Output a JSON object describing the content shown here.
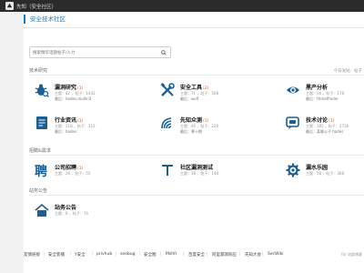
{
  "topbar": {
    "site_name": "先知（安全社区）"
  },
  "forum": {
    "title": "安全技术社区"
  },
  "search": {
    "placeholder": "搜索精华话题帖子/人力"
  },
  "sections": {
    "tech": {
      "title": "技术研究",
      "right": "今日发贴 · 帖子"
    },
    "recruit": {
      "title": "招聘&需求"
    },
    "notice": {
      "title": "站务公告"
    }
  },
  "tech_items": [
    {
      "name": "漏洞研究",
      "count": "(1)",
      "stats": "主题：82 ，帖子：1442",
      "last": "最后：hades.mullin3",
      "icon": "bug-icon"
    },
    {
      "name": "安全工具",
      "count": "(2)",
      "stats": "主题：71 ，帖子：508",
      "last": "最后：wolf",
      "icon": "tools-icon"
    },
    {
      "name": "黑产分析",
      "count": "",
      "stats": "主题：16 ，帖子：178",
      "last": "最后：threatfinder",
      "icon": "eye-icon"
    },
    {
      "name": "行业资讯",
      "count": "(1)",
      "stats": "主题：218 ，帖子：353",
      "last": "最后：hades",
      "icon": "news-icon"
    },
    {
      "name": "先知众测",
      "count": "(1)",
      "stats": "主题：40 ，帖子：229",
      "last": "最后：寒十朗",
      "icon": "signal-icon"
    },
    {
      "name": "技术讨论",
      "count": "(1)",
      "stats": "主题：185 ，帖子：2738",
      "last": "最后：某聊公子 hades",
      "icon": "chat-icon"
    }
  ],
  "recruit_items": [
    {
      "name": "公司招聘",
      "count": "(1)",
      "stats": "主题：26 ，帖子：55",
      "icon": "hire-icon"
    },
    {
      "name": "社区漏洞测试",
      "count": "",
      "stats": "主题：38 ，帖子：148",
      "icon": "test-icon"
    },
    {
      "name": "漏水乐园",
      "count": "",
      "stats": "主题：58 ，帖子：368",
      "icon": "gear-icon"
    }
  ],
  "notice_items": [
    {
      "name": "站务公告",
      "count": "",
      "stats": "主题：8 ，帖子：76",
      "icon": "house-icon"
    }
  ],
  "footer": {
    "links": [
      "友情链接",
      "安全客播",
      "Y安全",
      "privhub",
      "seebug",
      "安全圈",
      "Mshfr",
      "百度安全",
      "阿里漏洞响应",
      "先知大会",
      "SecWiki"
    ],
    "right": "for 站群博客"
  }
}
